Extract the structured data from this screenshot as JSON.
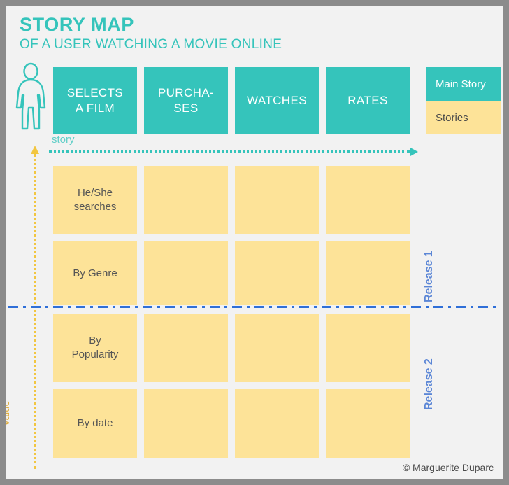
{
  "header": {
    "title": "STORY MAP",
    "subtitle": "OF A USER WATCHING A MOVIE ONLINE"
  },
  "colors": {
    "teal": "#35c4bb",
    "yellow": "#fde398",
    "blue": "#2f6fd8",
    "gold": "#f2c641",
    "canvas": "#f2f2f2",
    "frame": "#8c8c8c",
    "card_text": "#555555"
  },
  "persona": {
    "icon": "person-icon"
  },
  "axes": {
    "horizontal": {
      "label": "story",
      "icon": "arrow-right-dotted-icon"
    },
    "vertical": {
      "label": "value",
      "icon": "arrow-up-dotted-icon"
    }
  },
  "main_story": {
    "cards": [
      {
        "label": "SELECTS\nA FILM"
      },
      {
        "label": "PURCHA-\nSES"
      },
      {
        "label": "WATCHES"
      },
      {
        "label": "RATES"
      }
    ]
  },
  "stories": {
    "rows": [
      {
        "release": "Release 1",
        "cards": [
          "He/She\nsearches",
          "",
          "",
          ""
        ]
      },
      {
        "release": "Release 1",
        "cards": [
          "By Genre",
          "",
          "",
          ""
        ]
      },
      {
        "release": "Release 2",
        "cards": [
          "By\nPopularity",
          "",
          "",
          ""
        ]
      },
      {
        "release": "Release 2",
        "cards": [
          "By date",
          "",
          "",
          ""
        ]
      }
    ]
  },
  "releases": {
    "first": "Release 1",
    "second": "Release 2"
  },
  "legend": {
    "main_story": "Main Story",
    "stories": "Stories"
  },
  "footer": {
    "credit": "© Marguerite Duparc"
  }
}
